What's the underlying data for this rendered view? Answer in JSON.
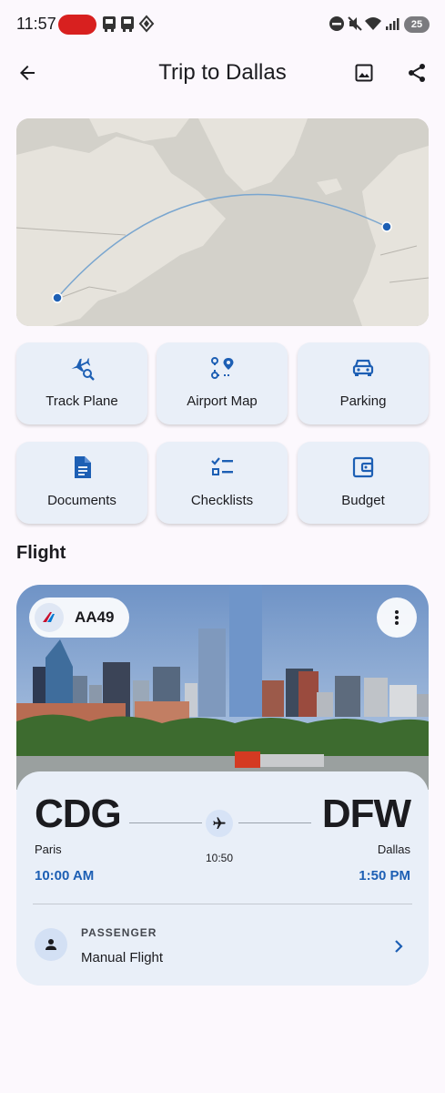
{
  "status_bar": {
    "time": "11:57",
    "battery": "25",
    "icons": [
      "recording-indicator",
      "app-notification-icon",
      "app-notification-icon",
      "diamond-icon",
      "do-not-disturb-icon",
      "mute-icon",
      "wifi-icon",
      "signal-icon",
      "battery-icon"
    ]
  },
  "app_bar": {
    "title": "Trip to Dallas",
    "back_icon": "arrow-back-icon",
    "actions": [
      "image-icon",
      "share-icon"
    ]
  },
  "map": {
    "route_color": "#7aa6cf",
    "dot_color": "#1d5fb4"
  },
  "quick_actions": [
    {
      "label": "Track Plane",
      "icon": "flight-search-icon"
    },
    {
      "label": "Airport Map",
      "icon": "route-map-icon"
    },
    {
      "label": "Parking",
      "icon": "car-icon"
    },
    {
      "label": "Documents",
      "icon": "document-icon"
    },
    {
      "label": "Checklists",
      "icon": "checklist-icon"
    },
    {
      "label": "Budget",
      "icon": "wallet-icon"
    }
  ],
  "section": {
    "title": "Flight"
  },
  "flight": {
    "number": "AA49",
    "airline_icon": "american-airlines-logo",
    "menu_icon": "more-vert-icon",
    "origin": {
      "code": "CDG",
      "city": "Paris",
      "time": "10:00 AM"
    },
    "destination": {
      "code": "DFW",
      "city": "Dallas",
      "time": "1:50 PM"
    },
    "duration": "10:50",
    "passenger": {
      "label": "PASSENGER",
      "value": "Manual Flight"
    }
  },
  "colors": {
    "accent": "#1d5fb4",
    "tile_background": "#e9eff8",
    "page_background": "#fcf8fd"
  }
}
